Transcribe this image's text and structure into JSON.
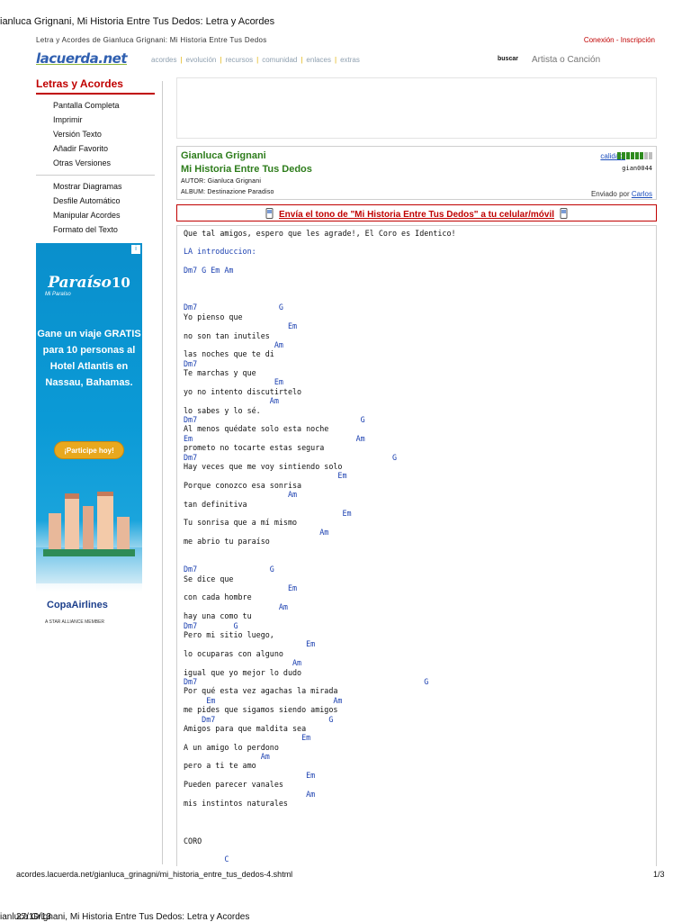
{
  "print": {
    "title": "ianluca Grignani, Mi Historia Entre Tus Dedos: Letra y Acordes",
    "url": "acordes.lacuerda.net/gianluca_grinagni/mi_historia_entre_tus_dedos-4.shtml",
    "page": "1/3",
    "footer_title": "ianluca Grignani, Mi Historia Entre Tus Dedos: Letra y Acordes",
    "footer_date": "27/10/13"
  },
  "header": {
    "breadcrumb": "Letra y Acordes de Gianluca Grignani: Mi Historia Entre Tus Dedos",
    "login": "Conexión",
    "register": "Inscripción",
    "logo": "lacuerda.net",
    "nav": [
      "acordes",
      "evolución",
      "recursos",
      "comunidad",
      "enlaces",
      "extras"
    ],
    "search_label": "buscar",
    "search_placeholder": "Artista o Canción"
  },
  "sidebar": {
    "title": "Letras y Acordes",
    "items_a": [
      "Pantalla Completa",
      "Imprimir",
      "Versión Texto",
      "Añadir Favorito",
      "Otras Versiones"
    ],
    "items_b": [
      "Mostrar Diagramas",
      "Desfile Automático",
      "Manipular Acordes",
      "Formato del Texto"
    ]
  },
  "ad": {
    "brand": "Paraíso",
    "brand_number": "10",
    "brand_sub": "Mi Paraíso",
    "headline": "Gane un viaje GRATIS para 10 personas al Hotel Atlantis en Nassau, Bahamas.",
    "cta": "¡Participe hoy!",
    "airline": "CopaAirlines",
    "airline_sub": "A STAR ALLIANCE MEMBER",
    "colors": {
      "sky": "#0a8fcc",
      "cta": "#e8a81e",
      "airline": "#1c3f8c"
    }
  },
  "song": {
    "artist": "Gianluca Grignani",
    "title": "Mi Historia Entre Tus Dedos",
    "author": "AUTOR: Gianluca Grignani",
    "album": "ALBUM: Destinazione Paradiso",
    "quality_label": "calidad:",
    "quality_level": 6,
    "quality_max": 8,
    "user": "gian0044",
    "sent_by_prefix": "Enviado por",
    "sent_by_name": "Carlos"
  },
  "ringtone": {
    "text": "Envía el tono de \"Mi Historia Entre Tus Dedos\" a tu celular/móvil"
  },
  "lyrics": {
    "intro": "Que tal amigos, espero que les agrade!, El Coro es Identico!",
    "lines": [
      {
        "t": "c",
        "s": "LA introduccion:"
      },
      {
        "t": "b",
        "s": ""
      },
      {
        "t": "c",
        "s": "Dm7 G Em Am"
      },
      {
        "t": "b",
        "s": ""
      },
      {
        "t": "b",
        "s": ""
      },
      {
        "t": "b",
        "s": ""
      },
      {
        "t": "c",
        "s": "Dm7                  G"
      },
      {
        "t": "x",
        "s": "Yo pienso que"
      },
      {
        "t": "c",
        "s": "                       Em"
      },
      {
        "t": "x",
        "s": "no son tan inutiles"
      },
      {
        "t": "c",
        "s": "                    Am"
      },
      {
        "t": "x",
        "s": "las noches que te di"
      },
      {
        "t": "c",
        "s": "Dm7"
      },
      {
        "t": "x",
        "s": "Te marchas y que"
      },
      {
        "t": "c",
        "s": "                    Em"
      },
      {
        "t": "x",
        "s": "yo no intento discutirtelo"
      },
      {
        "t": "c",
        "s": "                   Am"
      },
      {
        "t": "x",
        "s": "lo sabes y lo sé."
      },
      {
        "t": "c",
        "s": "Dm7                                    G"
      },
      {
        "t": "x",
        "s": "Al menos quédate solo esta noche"
      },
      {
        "t": "c",
        "s": "Em                                    Am"
      },
      {
        "t": "x",
        "s": "prometo no tocarte estas segura"
      },
      {
        "t": "c",
        "s": "Dm7                                           G"
      },
      {
        "t": "x",
        "s": "Hay veces que me voy sintiendo solo"
      },
      {
        "t": "c",
        "s": "                                  Em"
      },
      {
        "t": "x",
        "s": "Porque conozco esa sonrisa"
      },
      {
        "t": "c",
        "s": "                       Am"
      },
      {
        "t": "x",
        "s": "tan definitiva"
      },
      {
        "t": "c",
        "s": "                                   Em"
      },
      {
        "t": "x",
        "s": "Tu sonrisa que a mí mismo"
      },
      {
        "t": "c",
        "s": "                              Am"
      },
      {
        "t": "x",
        "s": "me abrio tu paraíso"
      },
      {
        "t": "b",
        "s": ""
      },
      {
        "t": "b",
        "s": ""
      },
      {
        "t": "c",
        "s": "Dm7                G"
      },
      {
        "t": "x",
        "s": "Se dice que"
      },
      {
        "t": "c",
        "s": "                       Em"
      },
      {
        "t": "x",
        "s": "con cada hombre"
      },
      {
        "t": "c",
        "s": "                     Am"
      },
      {
        "t": "x",
        "s": "hay una como tu"
      },
      {
        "t": "c",
        "s": "Dm7        G"
      },
      {
        "t": "x",
        "s": "Pero mi sitio luego,"
      },
      {
        "t": "c",
        "s": "                           Em"
      },
      {
        "t": "x",
        "s": "lo ocuparas con alguno"
      },
      {
        "t": "c",
        "s": "                        Am"
      },
      {
        "t": "x",
        "s": "igual que yo mejor lo dudo"
      },
      {
        "t": "c",
        "s": "Dm7                                                  G"
      },
      {
        "t": "x",
        "s": "Por qué esta vez agachas la mirada"
      },
      {
        "t": "c",
        "s": "     Em                          Am"
      },
      {
        "t": "x",
        "s": "me pides que sigamos siendo amigos"
      },
      {
        "t": "c",
        "s": "    Dm7                         G"
      },
      {
        "t": "x",
        "s": "Amigos para que maldita sea"
      },
      {
        "t": "c",
        "s": "                          Em"
      },
      {
        "t": "x",
        "s": "A un amigo lo perdono"
      },
      {
        "t": "c",
        "s": "                 Am"
      },
      {
        "t": "x",
        "s": "pero a ti te amo"
      },
      {
        "t": "c",
        "s": "                           Em"
      },
      {
        "t": "x",
        "s": "Pueden parecer vanales"
      },
      {
        "t": "c",
        "s": "                           Am"
      },
      {
        "t": "x",
        "s": "mis instintos naturales"
      },
      {
        "t": "b",
        "s": ""
      },
      {
        "t": "b",
        "s": ""
      },
      {
        "t": "b",
        "s": ""
      },
      {
        "t": "x",
        "s": "CORO"
      },
      {
        "t": "b",
        "s": ""
      },
      {
        "t": "c",
        "s": "         C"
      }
    ]
  }
}
